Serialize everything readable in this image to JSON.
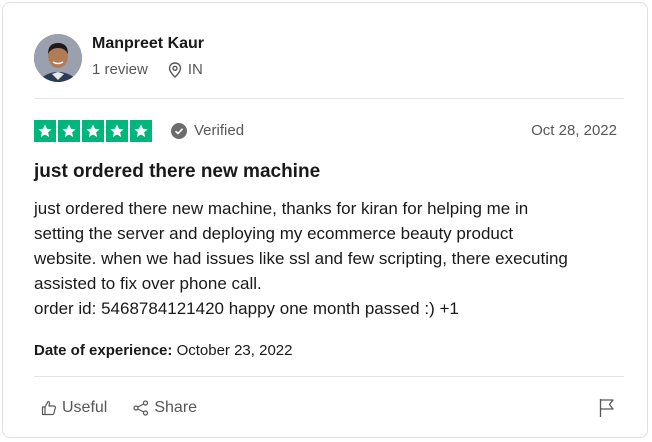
{
  "reviewer": {
    "name": "Manpreet Kaur",
    "reviews": "1 review",
    "country": "IN"
  },
  "rating": {
    "stars": 5,
    "verified_label": "Verified",
    "date": "Oct 28, 2022",
    "star_color": "#00b67a"
  },
  "review": {
    "title": "just ordered there new machine",
    "lines": [
      "just ordered there new machine, thanks for kiran for helping me in",
      "setting the server and deploying my ecommerce beauty product",
      "website. when we had issues like ssl and few scripting, there executing",
      "assisted to fix over phone call.",
      "order id: 5468784121420 happy one month passed :) +1"
    ]
  },
  "experience": {
    "label": "Date of experience:",
    "date": "October 23, 2022"
  },
  "actions": {
    "useful_label": "Useful",
    "share_label": "Share",
    "useful_icon": "thumbs-up-icon",
    "share_icon": "share-icon",
    "flag_icon": "flag-icon"
  }
}
